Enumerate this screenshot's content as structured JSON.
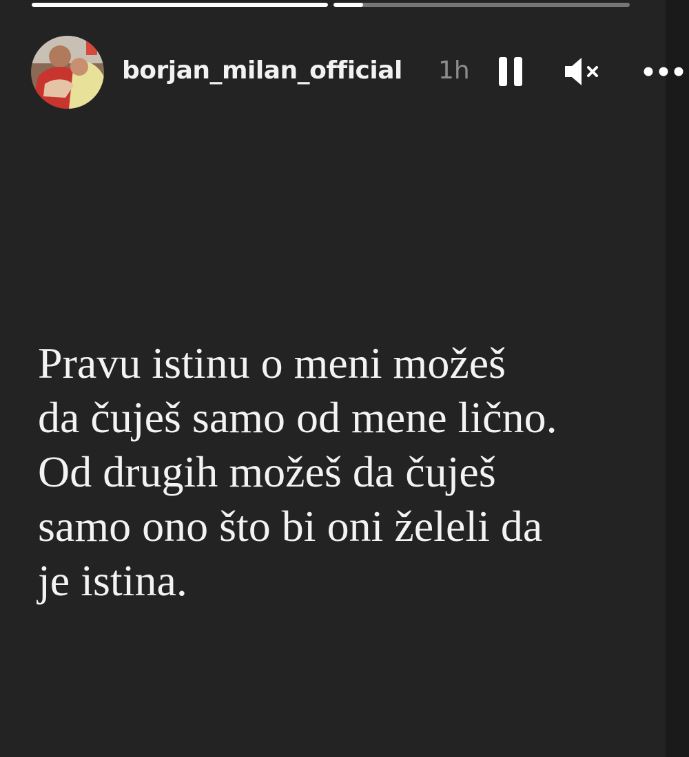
{
  "story": {
    "progress": [
      {
        "fill": 1.0
      },
      {
        "fill": 0.1
      }
    ],
    "header": {
      "username": "borjan_milan_official",
      "time_ago": "1h"
    },
    "controls": {
      "pause_icon": "pause-icon",
      "mute_icon": "muted-speaker-icon",
      "more_icon": "more-options-icon"
    },
    "text_lines": [
      "Pravu istinu o meni možeš",
      "da čuješ samo od mene lično.",
      "Od drugih možeš da čuješ",
      "samo ono što bi oni želeli da",
      "je istina."
    ],
    "colors": {
      "background": "#232323",
      "text": "#f3f3f3",
      "muted": "#8e8e8e"
    }
  }
}
